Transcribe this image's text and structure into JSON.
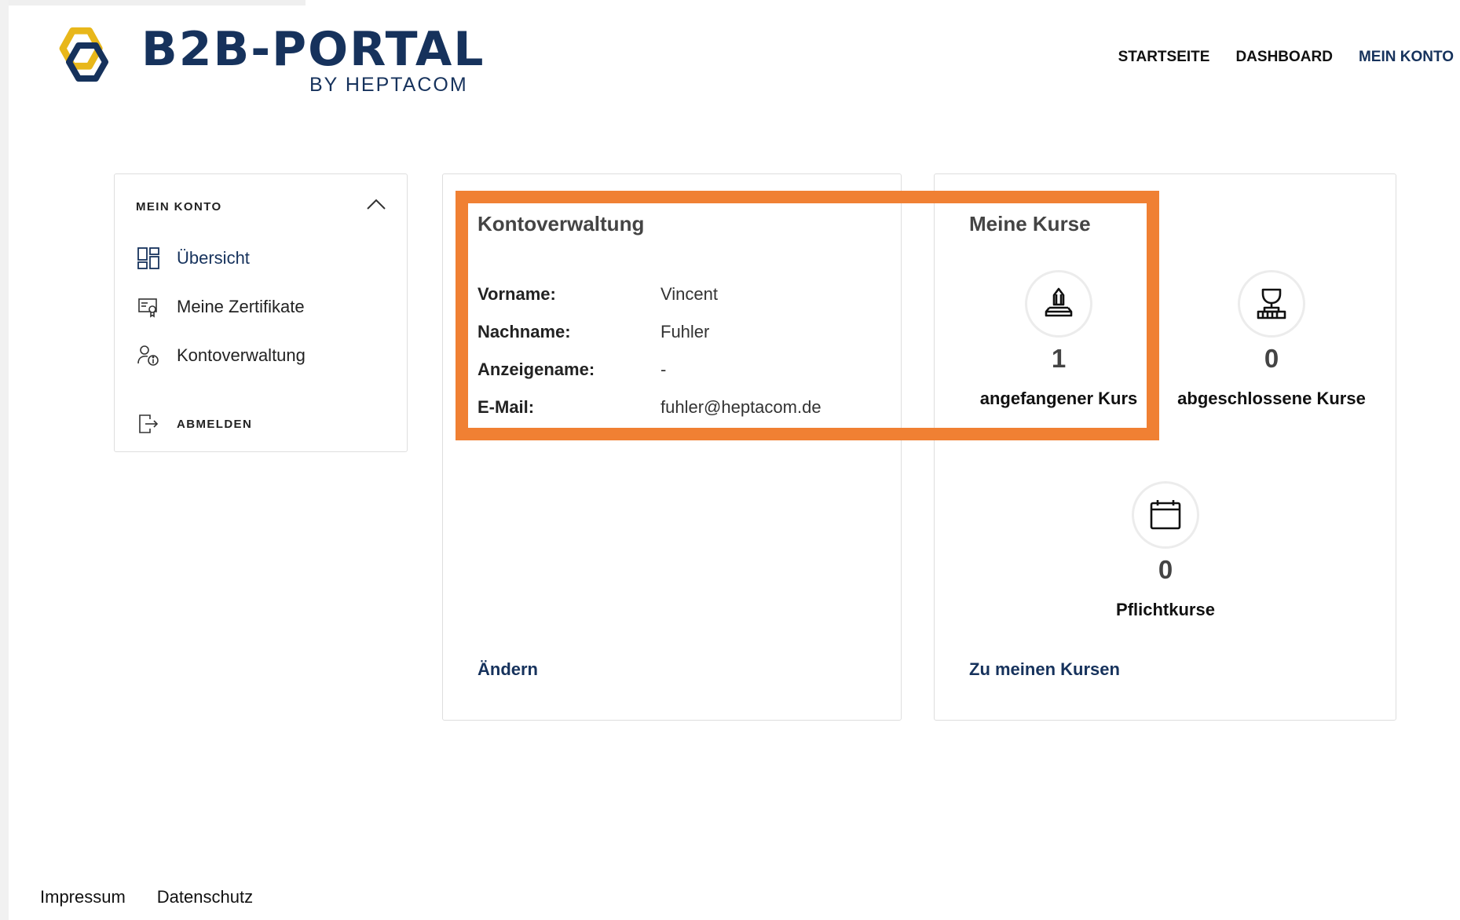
{
  "header": {
    "logo_title": "B2B-PORTAL",
    "logo_subtitle": "BY HEPTACOM",
    "nav": [
      "STARTSEITE",
      "DASHBOARD",
      "MEIN KONTO"
    ],
    "active_nav": "MEIN KONTO"
  },
  "sidebar": {
    "title": "MEIN KONTO",
    "items": [
      {
        "label": "Übersicht",
        "icon": "dashboard-icon",
        "active": true
      },
      {
        "label": "Meine Zertifikate",
        "icon": "certificate-icon"
      },
      {
        "label": "Kontoverwaltung",
        "icon": "user-info-icon"
      }
    ],
    "logout_label": "ABMELDEN"
  },
  "account": {
    "title": "Kontoverwaltung",
    "fields": [
      {
        "label": "Vorname:",
        "value": "Vincent"
      },
      {
        "label": "Nachname:",
        "value": "Fuhler"
      },
      {
        "label": "Anzeigename:",
        "value": "-"
      },
      {
        "label": "E-Mail:",
        "value": "fuhler@heptacom.de"
      }
    ],
    "edit_link": "Ändern"
  },
  "courses": {
    "title": "Meine Kurse",
    "stats": [
      {
        "count": "1",
        "label": "angefangener Kurs",
        "icon": "course-started-icon"
      },
      {
        "count": "0",
        "label": "abgeschlossene Kurse",
        "icon": "trophy-icon"
      },
      {
        "count": "0",
        "label": "Pflichtkurse",
        "icon": "calendar-icon"
      }
    ],
    "link": "Zu meinen Kursen"
  },
  "footer": {
    "links": [
      "Impressum",
      "Datenschutz"
    ]
  },
  "colors": {
    "brand": "#16325c",
    "accent_yellow": "#e8b71a",
    "highlight": "#f08033"
  }
}
